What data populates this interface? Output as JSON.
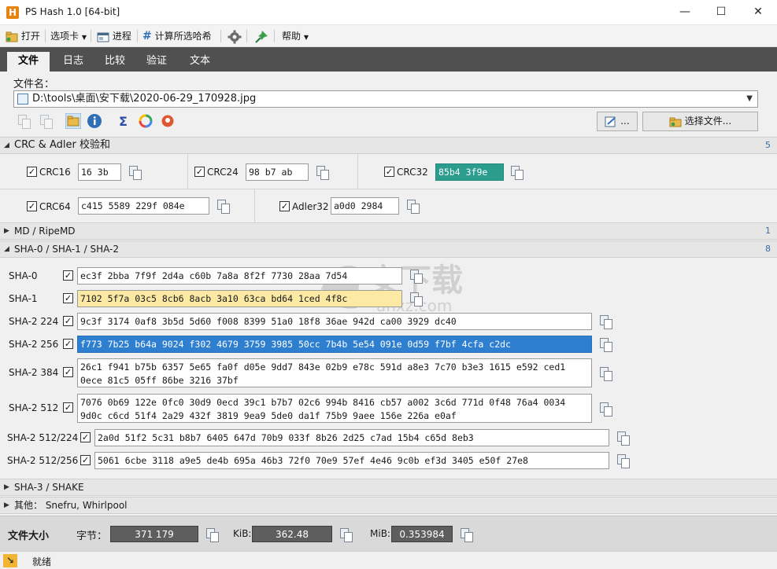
{
  "window": {
    "title": "PS Hash 1.0    [64-bit]",
    "logo_letter": "H",
    "minimize": "—",
    "maximize": "☐",
    "close": "✕"
  },
  "toolbar": {
    "open": "打开",
    "options": "选项卡",
    "process": "进程",
    "compute_selected": "计算所选哈希",
    "help": "帮助"
  },
  "tabs": [
    "文件",
    "日志",
    "比较",
    "验证",
    "文本"
  ],
  "file": {
    "label": "文件名：",
    "path": "D:\\tools\\桌面\\安下载\\2020-06-29_170928.jpg",
    "edit_button": "...",
    "choose_button": "选择文件..."
  },
  "groups": {
    "crc": {
      "title": "CRC & Adler 校验和",
      "count": "5"
    },
    "md": {
      "title": "MD / RipeMD",
      "count": "1"
    },
    "sha": {
      "title": "SHA-0 / SHA-1 / SHA-2",
      "count": "8"
    },
    "sha3": {
      "title": "SHA-3 / SHAKE"
    },
    "other": {
      "title": "其他：  Snefru, Whirlpool"
    }
  },
  "crc": {
    "crc16": {
      "label": "CRC16",
      "value": "16 3b"
    },
    "crc24": {
      "label": "CRC24",
      "value": "98 b7 ab"
    },
    "crc32": {
      "label": "CRC32",
      "value": "85b4 3f9e"
    },
    "crc64": {
      "label": "CRC64",
      "value": "c415 5589 229f 084e"
    },
    "adler32": {
      "label": "Adler32",
      "value": "a0d0 2984"
    }
  },
  "sha": {
    "sha0": {
      "label": "SHA-0",
      "value": "ec3f 2bba 7f9f 2d4a c60b 7a8a 8f2f 7730 28aa 7d54"
    },
    "sha1": {
      "label": "SHA-1",
      "value": "7102 5f7a 03c5 8cb6 8acb 3a10 63ca bd64 1ced 4f8c"
    },
    "sha224": {
      "label": "SHA-2 224",
      "value": "9c3f 3174 0af8 3b5d 5d60 f008 8399 51a0 18f8 36ae 942d ca00 3929 dc40"
    },
    "sha256": {
      "label": "SHA-2 256",
      "value": "f773 7b25 b64a 9024 f302 4679 3759 3985 50cc 7b4b 5e54 091e 0d59 f7bf 4cfa c2dc"
    },
    "sha384": {
      "label": "SHA-2 384",
      "value": "26c1 f941 b75b 6357 5e65 fa0f d05e 9dd7 843e 02b9 e78c 591d a8e3 7c70 b3e3 1615 e592 ced1\n0ece 81c5 05ff 86be 3216 37bf"
    },
    "sha512": {
      "label": "SHA-2 512",
      "value": "7076 0b69 122e 0fc0 30d9 0ecd 39c1 b7b7 02c6 994b 8416 cb57 a002 3c6d 771d 0f48 76a4 0034\n9d0c c6cd 51f4 2a29 432f 3819 9ea9 5de0 da1f 75b9 9aee 156e 226a e0af"
    },
    "sha512_224": {
      "label": "SHA-2 512/224",
      "value": "2a0d 51f2 5c31 b8b7 6405 647d 70b9 033f 8b26 2d25 c7ad 15b4 c65d 8eb3"
    },
    "sha512_256": {
      "label": "SHA-2 512/256",
      "value": "5061 6cbe 3118 a9e5 de4b 695a 46b3 72f0 70e9 57ef 4e46 9c0b ef3d 3405 e50f 27e8"
    }
  },
  "size": {
    "label": "文件大小",
    "bytes_label": "字节：",
    "bytes": "371 179",
    "kib_label": "KiB:",
    "kib": "362.48",
    "mib_label": "MiB:",
    "mib": "0.353984"
  },
  "status": {
    "text": "就绪"
  }
}
